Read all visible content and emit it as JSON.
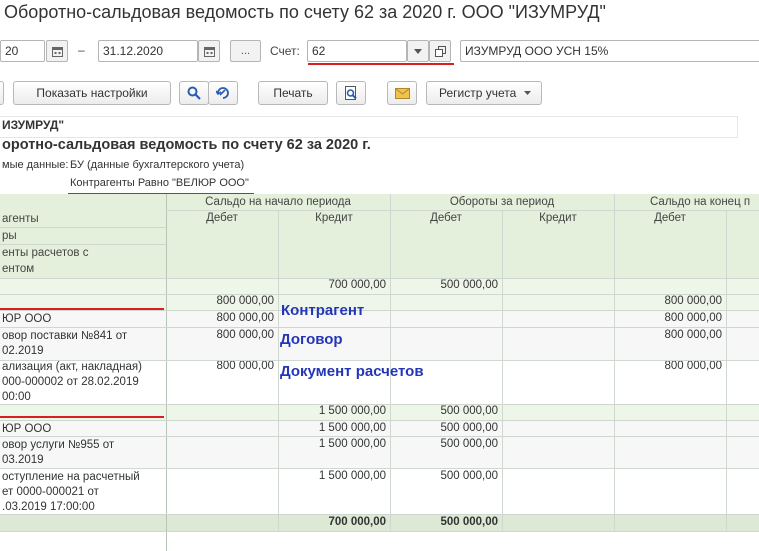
{
  "window": {
    "title": "Оборотно-сальдовая ведомость по счету 62 за 2020 г. ООО \"ИЗУМРУД\""
  },
  "filters": {
    "date_from": "20",
    "date_dash": "–",
    "date_to": "31.12.2020",
    "ellipsis": "...",
    "account_label": "Счет:",
    "account_value": "62",
    "org_value": "ИЗУМРУД ООО УСН 15%"
  },
  "toolbar": {
    "settings_label": "Показать настройки",
    "print_label": "Печать",
    "register_label": "Регистр учета"
  },
  "report": {
    "org_name": "ИЗУМРУД\"",
    "heading": "оротно-сальдовая ведомость по счету 62 за 2020 г.",
    "data_label": "мые данные:",
    "data_value": "БУ (данные бухгалтерского учета)",
    "filter_value": "Контрагенты Равно \"ВЕЛЮР ООО\""
  },
  "table": {
    "group_headers": [
      "Сальдо на начало периода",
      "Обороты за период",
      "Сальдо на конец п"
    ],
    "sub_headers": [
      "Дебет",
      "Кредит",
      "Дебет",
      "Кредит",
      "Дебет"
    ],
    "left_headers": [
      "агенты",
      "ры",
      "енты расчетов с",
      "ентом"
    ],
    "rows": [
      {
        "label": "",
        "c1": "",
        "c2": "700 000,00",
        "c3": "500 000,00",
        "c4": "",
        "c5": ""
      },
      {
        "label": "",
        "c1": "800 000,00",
        "c2": "",
        "c3": "",
        "c4": "",
        "c5": "800 000,00"
      },
      {
        "label": "ЮР ООО",
        "c1": "800 000,00",
        "c2": "",
        "c3": "",
        "c4": "",
        "c5": "800 000,00"
      },
      {
        "label": "овор поставки №841 от",
        "label2": "02.2019",
        "c1": "800 000,00",
        "c2": "",
        "c3": "",
        "c4": "",
        "c5": "800 000,00"
      },
      {
        "label": "ализация (акт, накладная)",
        "label2": "000-000002 от 28.02.2019",
        "label3": "00:00",
        "c1": "800 000,00",
        "c2": "",
        "c3": "",
        "c4": "",
        "c5": "800 000,00"
      },
      {
        "label": "",
        "c1": "",
        "c2": "1 500 000,00",
        "c3": "500 000,00",
        "c4": "",
        "c5": ""
      },
      {
        "label": "ЮР ООО",
        "c1": "",
        "c2": "1 500 000,00",
        "c3": "500 000,00",
        "c4": "",
        "c5": ""
      },
      {
        "label": "овор услуги №955 от",
        "label2": "03.2019",
        "c1": "",
        "c2": "1 500 000,00",
        "c3": "500 000,00",
        "c4": "",
        "c5": ""
      },
      {
        "label": "оступление на расчетный",
        "label2": "ет 0000-000021 от",
        "label3": ".03.2019 17:00:00",
        "c1": "",
        "c2": "1 500 000,00",
        "c3": "500 000,00",
        "c4": "",
        "c5": ""
      }
    ],
    "total": {
      "c2": "700 000,00",
      "c3": "500 000,00"
    }
  },
  "annotations": {
    "counterparty": "Контрагент",
    "contract": "Договор",
    "document": "Документ расчетов"
  },
  "colors": {
    "header_bg": "#e4efdc",
    "group_bg": "#eef6ea",
    "accent_red": "#d81e1e",
    "annot_blue": "#2436b8"
  }
}
